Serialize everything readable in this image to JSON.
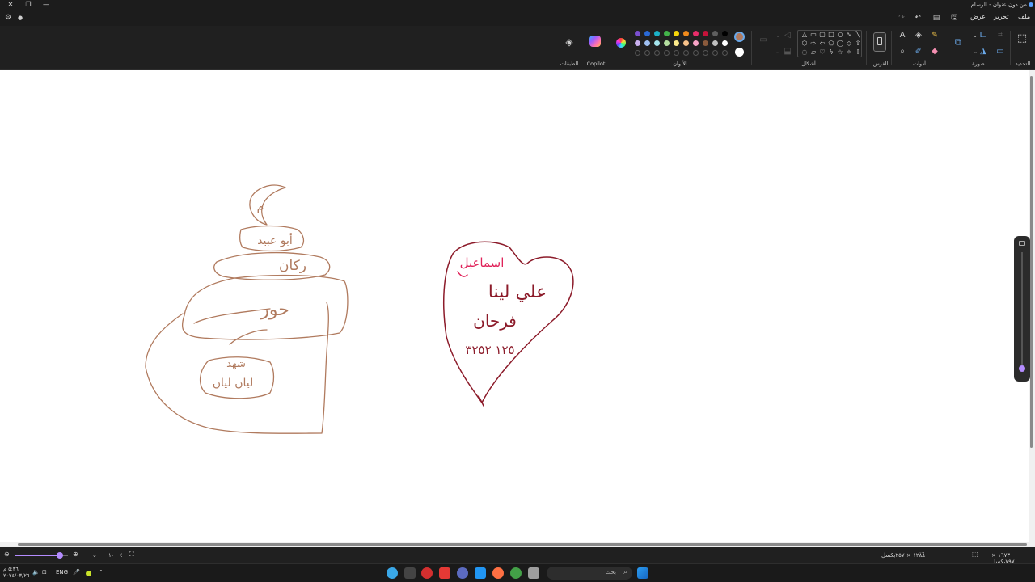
{
  "window": {
    "title": "من دون عنوان - الرسام",
    "controls": {
      "close": "✕",
      "restore": "❐",
      "minimize": "—"
    }
  },
  "menu": {
    "file": "ملف",
    "edit": "تحرير",
    "view": "عرض"
  },
  "ribbon": {
    "groups": {
      "selection": "التحديد",
      "image": "صورة",
      "tools": "أدوات",
      "brushes": "الفرش",
      "shapes": "أشكال",
      "colors": "الألوان",
      "copilot": "Copilot",
      "layers": "الطبقات"
    },
    "colors": {
      "current_primary": "#b07a5e",
      "current_secondary": "#ffffff",
      "palette_row1": [
        "#000000",
        "#5f5f5f",
        "#c4133a",
        "#e82d6b",
        "#f08a1c",
        "#f5d50a",
        "#43b34a",
        "#1bb2c8",
        "#2a6ad6",
        "#7a4fd0"
      ],
      "palette_row2": [
        "#ffffff",
        "#c0c0c0",
        "#8a5a3c",
        "#f7a3c6",
        "#f8c28a",
        "#fbe98a",
        "#b5e0a0",
        "#a4e4ec",
        "#9fc0f2",
        "#c9b0ef"
      ]
    }
  },
  "canvas": {
    "drawing": {
      "cake_texts": [
        "م",
        "أبو عبيد",
        "ركان",
        "حور",
        "شهد",
        "ليان ليان"
      ],
      "heart_texts": [
        "اسماعيل",
        "علي لينا",
        "فرحان",
        "١٢٥ ٣٢٥٢"
      ]
    },
    "colors": {
      "brown": "#b07a5e",
      "crimson": "#8c1b2a",
      "red_marker": "#e0235a"
    }
  },
  "status": {
    "canvas_size": "١٦٧٣ × ٧٩٧بكسل",
    "selection_size": "١٢٨٨ × ٢٥٧بكسل",
    "zoom": "١٠٠ ٪"
  },
  "taskbar": {
    "search_placeholder": "بحث",
    "lang": "ENG",
    "time": "٥:٣٦ م",
    "date": "٢٠٢٤/٠٣/٢٦"
  }
}
